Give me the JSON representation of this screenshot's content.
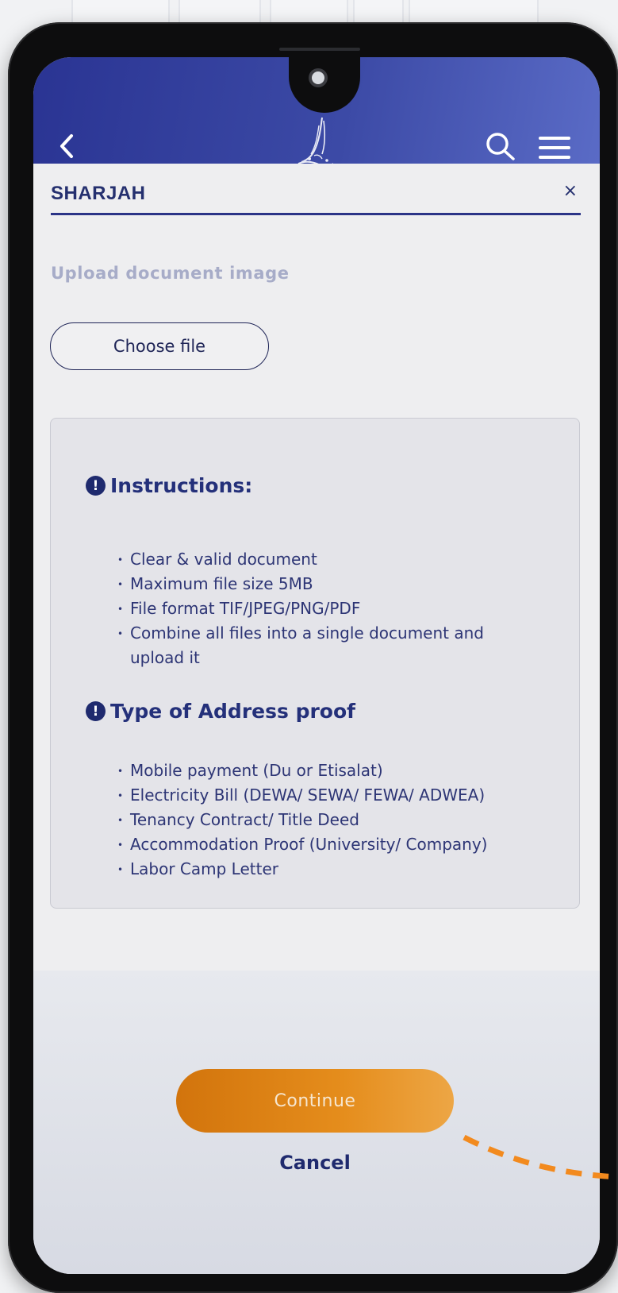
{
  "header": {
    "back_icon": "chevron-left-icon",
    "logo_icon": "calligraphy-logo-icon",
    "search_icon": "search-icon",
    "menu_icon": "hamburger-menu-icon"
  },
  "panel": {
    "title": "SHARJAH",
    "close_label": "×"
  },
  "upload": {
    "label": "Upload document image",
    "choose_file": "Choose file"
  },
  "instructions": {
    "heading": "Instructions:",
    "items": [
      "Clear & valid document",
      "Maximum file size 5MB",
      "File format TIF/JPEG/PNG/PDF",
      "Combine all files into a single document and",
      "upload it"
    ]
  },
  "address_proof": {
    "heading": "Type of Address proof",
    "items": [
      "Mobile payment (Du or Etisalat)",
      "Electricity Bill (DEWA/ SEWA/ FEWA/ ADWEA)",
      "Tenancy Contract/ Title Deed",
      "Accommodation Proof (University/ Company)",
      "Labor Camp Letter"
    ]
  },
  "actions": {
    "continue": "Continue",
    "cancel": "Cancel"
  },
  "colors": {
    "header_primary": "#2a3493",
    "accent_orange": "#e58d1c",
    "text_navy": "#1f2a6e",
    "annotation": "#f28a1e"
  }
}
